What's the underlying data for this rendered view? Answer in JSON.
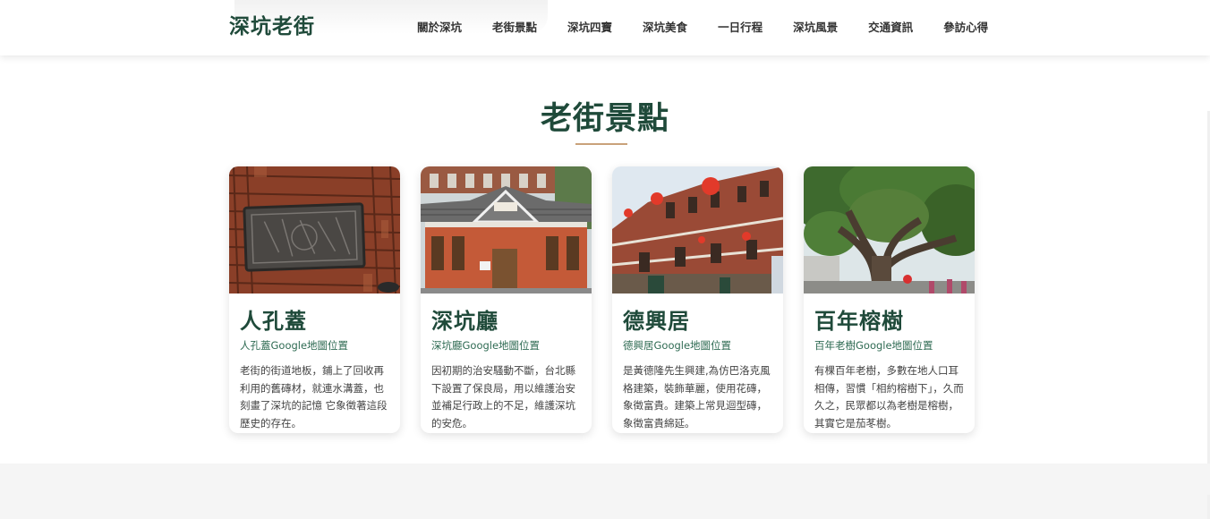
{
  "header": {
    "logo": "深坑老街",
    "nav": [
      "關於深坑",
      "老街景點",
      "深坑四寶",
      "深坑美食",
      "一日行程",
      "深坑風景",
      "交通資訊",
      "參訪心得"
    ]
  },
  "section": {
    "title": "老街景點"
  },
  "cards": [
    {
      "title": "人孔蓋",
      "link": "人孔蓋Google地圖位置",
      "desc": "老街的街道地板，鋪上了回收再利用的舊磚材，就連水溝蓋，也刻畫了深坑的記憶 它象徵著這段歷史的存在。"
    },
    {
      "title": "深坑廳",
      "link": "深坑廳Google地圖位置",
      "desc": "因初期的治安騷動不斷，台北縣下設置了保良局，用以維護治安並補足行政上的不足，維護深坑的安危。"
    },
    {
      "title": "德興居",
      "link": "德興居Google地圖位置",
      "desc": "是黃德隆先生興建,為仿巴洛克風格建築，裝飾華麗，使用花磚，象徵富貴。建築上常見迴型磚，象徵富貴綿延。"
    },
    {
      "title": "百年榕樹",
      "link": "百年老樹Google地圖位置",
      "desc": "有棵百年老樹，多數在地人口耳相傳，習慣「相約榕樹下」，久而久之，民眾都以為老樹是榕樹，其實它是茄苳樹。"
    }
  ],
  "colors": {
    "brand_green": "#1f4a3a",
    "link_green": "#2f6b53",
    "accent_gold": "#c9a27a"
  }
}
